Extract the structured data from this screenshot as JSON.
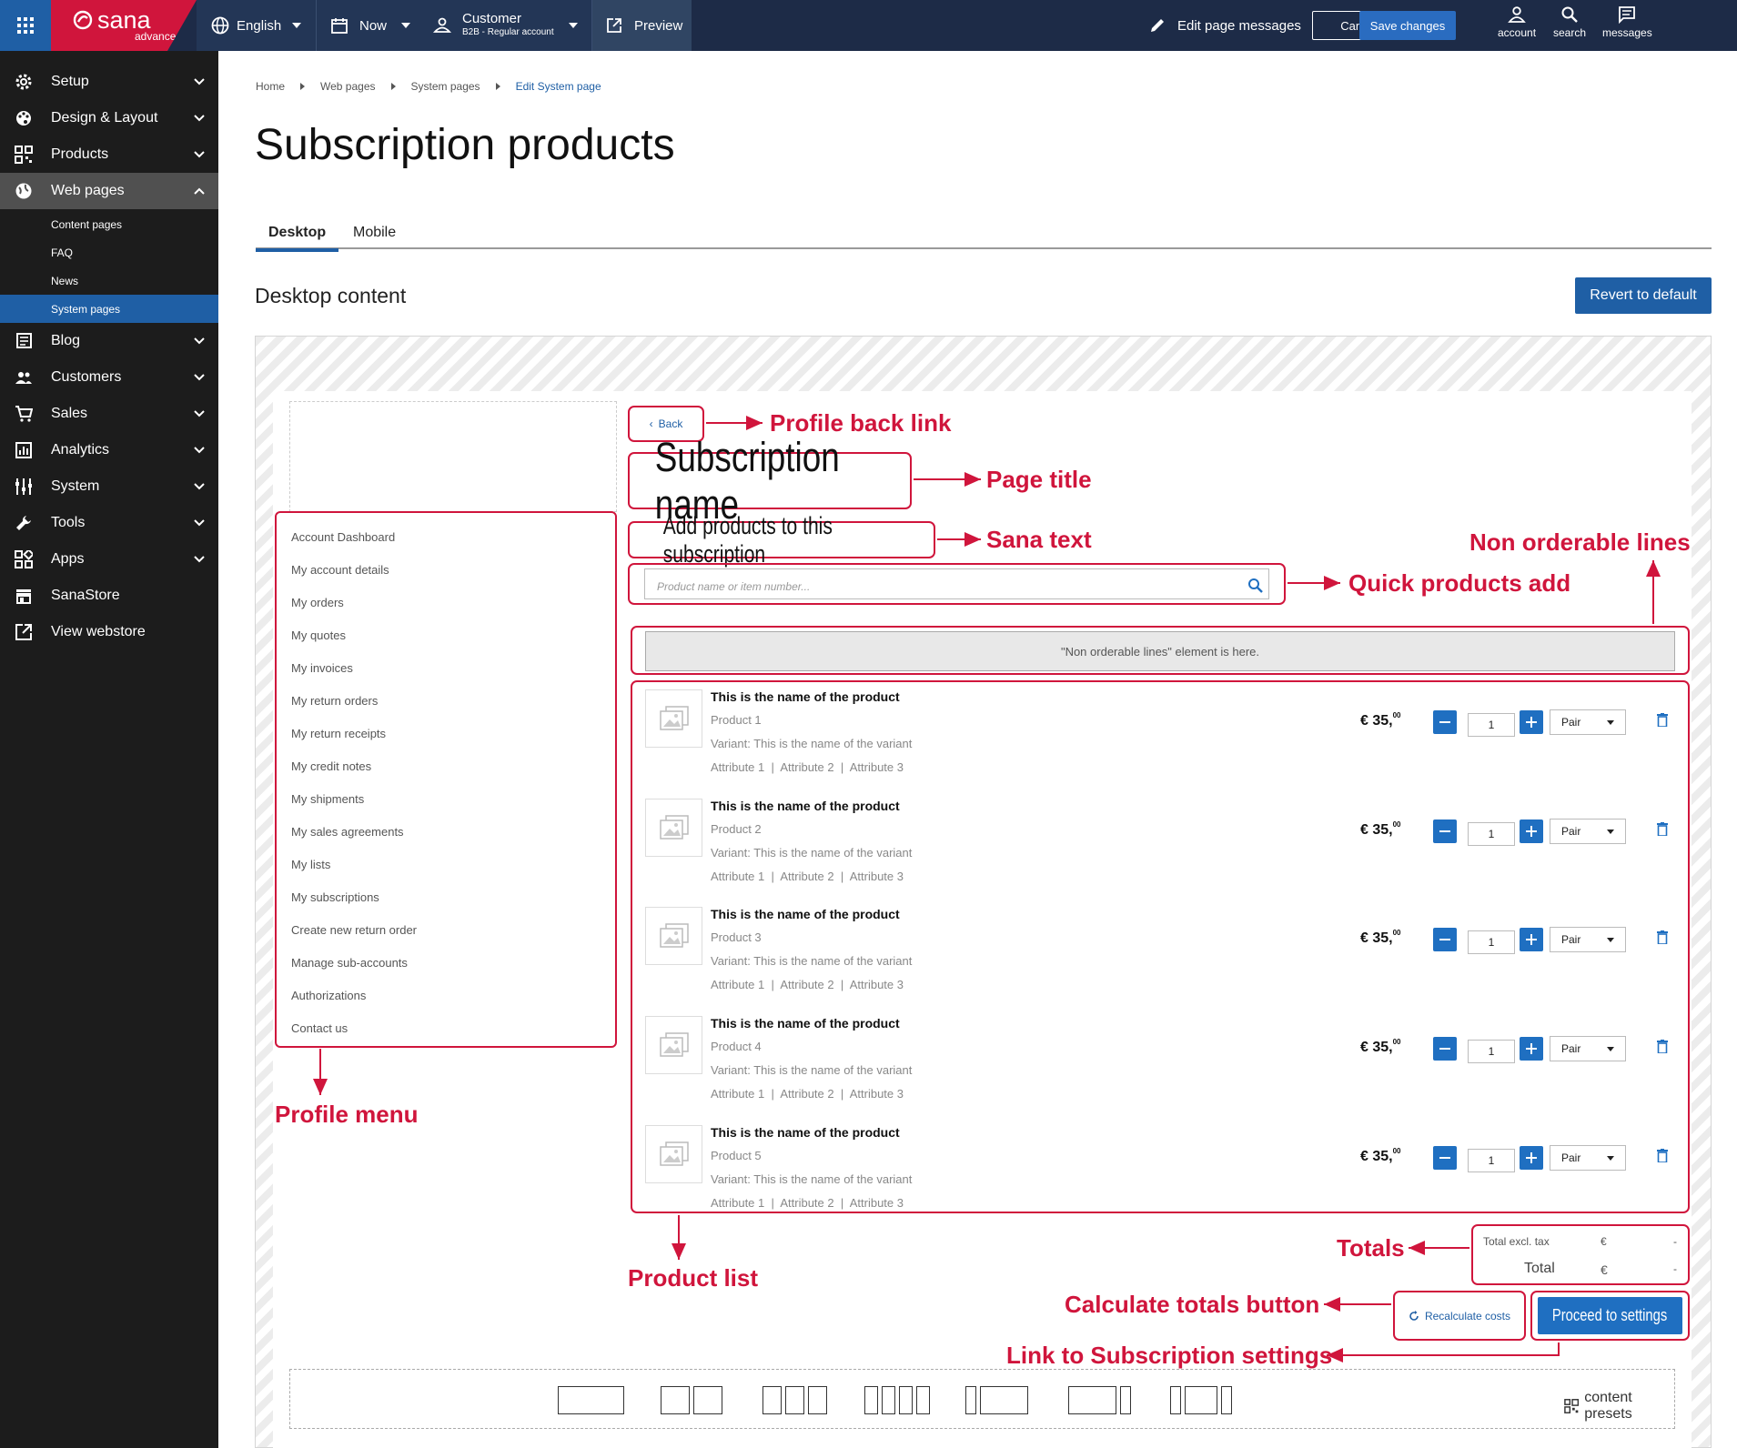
{
  "topbar": {
    "logo": "sana",
    "logo_sub": "advanced",
    "language": "English",
    "date": "Now",
    "customer": "Customer",
    "customer_sub": "B2B - Regular account",
    "preview": "Preview",
    "edit_messages": "Edit page messages",
    "cancel": "Cancel",
    "save": "Save changes",
    "account": "account",
    "search": "search",
    "messages": "messages"
  },
  "sidebar": {
    "items": [
      {
        "label": "Setup",
        "icon": "gear-icon"
      },
      {
        "label": "Design & Layout",
        "icon": "palette-icon"
      },
      {
        "label": "Products",
        "icon": "qr-icon"
      },
      {
        "label": "Web pages",
        "icon": "globe-icon"
      },
      {
        "label": "Blog",
        "icon": "blog-icon"
      },
      {
        "label": "Customers",
        "icon": "users-icon"
      },
      {
        "label": "Sales",
        "icon": "cart-icon"
      },
      {
        "label": "Analytics",
        "icon": "chart-icon"
      },
      {
        "label": "System",
        "icon": "sliders-icon"
      },
      {
        "label": "Tools",
        "icon": "wrench-icon"
      },
      {
        "label": "Apps",
        "icon": "apps-icon"
      },
      {
        "label": "SanaStore",
        "icon": "store-icon"
      },
      {
        "label": "View webstore",
        "icon": "external-icon"
      }
    ],
    "sub_items": [
      "Content pages",
      "FAQ",
      "News",
      "System pages"
    ]
  },
  "breadcrumb": [
    "Home",
    "Web pages",
    "System pages",
    "Edit System page"
  ],
  "page_title": "Subscription products",
  "tabs": [
    "Desktop",
    "Mobile"
  ],
  "section_title": "Desktop content",
  "revert_button": "Revert to default",
  "profile_menu": [
    "Account Dashboard",
    "My account details",
    "My orders",
    "My quotes",
    "My invoices",
    "My return orders",
    "My return receipts",
    "My credit notes",
    "My shipments",
    "My sales agreements",
    "My lists",
    "My subscriptions",
    "Create new return order",
    "Manage sub-accounts",
    "Authorizations",
    "Contact us"
  ],
  "back_link": "Back",
  "subscription_name": "Subscription name",
  "sana_text": "Add products to this subscription",
  "quick_add_placeholder": "Product name or item number...",
  "non_orderable_text": "\"Non orderable lines\" element is here.",
  "products": [
    {
      "name": "This is the name of the product",
      "id": "Product 1",
      "variant": "Variant: This is the name of the variant",
      "attributes": "Attribute 1  |  Attribute 2  |  Attribute 3",
      "price": "€ 35,",
      "price_dec": "00",
      "qty": "1",
      "uom": "Pair"
    },
    {
      "name": "This is the name of the product",
      "id": "Product 2",
      "variant": "Variant: This is the name of the variant",
      "attributes": "Attribute 1  |  Attribute 2  |  Attribute 3",
      "price": "€ 35,",
      "price_dec": "00",
      "qty": "1",
      "uom": "Pair"
    },
    {
      "name": "This is the name of the product",
      "id": "Product 3",
      "variant": "Variant: This is the name of the variant",
      "attributes": "Attribute 1  |  Attribute 2  |  Attribute 3",
      "price": "€ 35,",
      "price_dec": "00",
      "qty": "1",
      "uom": "Pair"
    },
    {
      "name": "This is the name of the product",
      "id": "Product 4",
      "variant": "Variant: This is the name of the variant",
      "attributes": "Attribute 1  |  Attribute 2  |  Attribute 3",
      "price": "€ 35,",
      "price_dec": "00",
      "qty": "1",
      "uom": "Pair"
    },
    {
      "name": "This is the name of the product",
      "id": "Product 5",
      "variant": "Variant: This is the name of the variant",
      "attributes": "Attribute 1  |  Attribute 2  |  Attribute 3",
      "price": "€ 35,",
      "price_dec": "00",
      "qty": "1",
      "uom": "Pair"
    }
  ],
  "totals": {
    "excl_label": "Total excl. tax",
    "total_label": "Total",
    "currency": "€",
    "excl_value": "-",
    "total_value": "-"
  },
  "recalc_label": "Recalculate costs",
  "proceed_label": "Proceed to settings",
  "content_presets": "content presets",
  "annotations": {
    "profile_back_link": "Profile back link",
    "page_title": "Page title",
    "sana_text": "Sana text",
    "non_orderable": "Non orderable lines",
    "quick_add": "Quick products add",
    "profile_menu": "Profile menu",
    "product_list": "Product list",
    "totals": "Totals",
    "calc_totals": "Calculate totals button",
    "link_settings": "Link to Subscription settings"
  },
  "colors": {
    "accent": "#1f5fa5",
    "annotation": "#d0153c",
    "topbar": "#1d2b47",
    "sidebar": "#1c1c1c"
  }
}
